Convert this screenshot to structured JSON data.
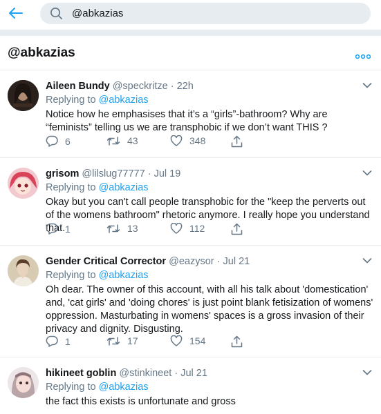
{
  "search": {
    "query": "@abkazias"
  },
  "header": {
    "title": "@abkazias"
  },
  "colors": {
    "accent": "#1da1f2",
    "muted": "#657786",
    "text": "#14171a"
  },
  "icons": [
    "back-arrow-icon",
    "search-icon",
    "more-options-icon",
    "chevron-down-icon",
    "reply-icon",
    "retweet-icon",
    "like-icon",
    "share-icon"
  ],
  "tweets": [
    {
      "name": "Aileen Bundy",
      "handle": "@speckritze",
      "dot": "·",
      "time": "22h",
      "replying_prefix": "Replying to",
      "replying_to": "@abkazias",
      "text": "Notice how he emphasises that it’s a “girls”-bathroom? Why are “feminists” telling us we are transphobic if we don’t want THIS ?",
      "replies": "6",
      "retweets": "43",
      "likes": "348"
    },
    {
      "name": "grisom",
      "handle": "@lilslug77777",
      "dot": "·",
      "time": "Jul 19",
      "replying_prefix": "Replying to",
      "replying_to": "@abkazias",
      "text": "Okay but you can't call people transphobic for the \"keep the perverts out of the womens bathroom\" rhetoric anymore. I really hope you understand that.",
      "replies": "1",
      "retweets": "13",
      "likes": "112"
    },
    {
      "name": "Gender Critical Corrector",
      "handle": "@eazysor",
      "dot": "·",
      "time": "Jul 21",
      "replying_prefix": "Replying to",
      "replying_to": "@abkazias",
      "text": "Oh dear. The owner of this account, with all his talk about 'domestication' and, 'cat girls' and 'doing chores' is just point blank fetisization of womens' oppression. Masturbating in womens' spaces is a gross invasion of their privacy and dignity. Disgusting.",
      "replies": "1",
      "retweets": "17",
      "likes": "154"
    },
    {
      "name": "hikineet goblin",
      "handle": "@stinkineet",
      "dot": "·",
      "time": "Jul 21",
      "replying_prefix": "Replying to",
      "replying_to": "@abkazias",
      "text": "the fact this exists is unfortunate and gross"
    }
  ]
}
